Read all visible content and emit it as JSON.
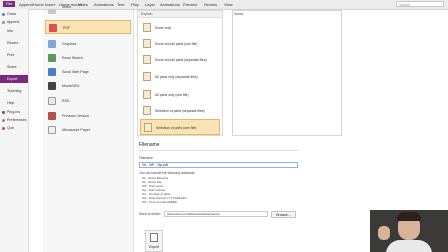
{
  "menubar": {
    "items": [
      "File",
      "Append",
      "Home",
      "Insert",
      "Home mount",
      "Video",
      "Animations",
      "Text",
      "Play",
      "Layer",
      "Animations",
      "Preview",
      "Review",
      "View"
    ],
    "active_index": 0,
    "search_placeholder": "Search"
  },
  "sidebar": {
    "items": [
      {
        "label": "Close",
        "icon": "folder-icon"
      },
      {
        "label": "Append",
        "icon": "document-icon"
      },
      {
        "label": "Info",
        "icon": ""
      },
      {
        "label": "Recent",
        "icon": ""
      },
      {
        "label": "Print",
        "icon": ""
      },
      {
        "label": "Share",
        "icon": ""
      },
      {
        "label": "Export",
        "icon": ""
      },
      {
        "label": "Teaching",
        "icon": ""
      },
      {
        "label": "Help",
        "icon": ""
      },
      {
        "label": "Plug-ins",
        "icon": "plugin-icon"
      },
      {
        "label": "Preferences",
        "icon": "gear-icon"
      },
      {
        "label": "Quit",
        "icon": "quit-icon"
      }
    ],
    "active_label": "Export"
  },
  "types": {
    "items": [
      {
        "label": "Video"
      },
      {
        "label": "PDF"
      },
      {
        "label": "Graphics"
      },
      {
        "label": "Excel Sketch"
      },
      {
        "label": "Scroll Web Page"
      },
      {
        "label": "Movie/URL"
      },
      {
        "label": "RSS"
      },
      {
        "label": "Previous Version"
      },
      {
        "label": "Micrascript Paper"
      }
    ],
    "active_label": "PDF"
  },
  "options": {
    "header": "Explain",
    "items": [
      "Score only",
      "Score and all parts (one file)",
      "Score and all parts (separate files)",
      "All parts only (separate files)",
      "All parts only (one file)",
      "Selection of parts (separate files)",
      "Selection of parts (one file)"
    ],
    "active_label": "Selection of parts (one file)"
  },
  "notes": {
    "label": "Notes"
  },
  "filename": {
    "section_title": "Filename",
    "field_label": "Filename",
    "value": "%t - %P - %p.pdf",
    "wildcard_intro": "You can include the following wildcards:",
    "wildcards": [
      "%f - Score filename",
      "%t - Score title",
      "%P - Part name",
      "%p - Part number",
      "%n - Number of parts",
      "%d - Date (format YYYY-MM-DD)",
      "%h - Time (format HHMM)"
    ],
    "save_label": "Save to folder:",
    "save_path": "/Users/tomecsoft/Downloads/arpuccos",
    "browse_label": "Browse..."
  },
  "export_button": {
    "label": "Export"
  },
  "colors": {
    "accent": "#7a2a7e",
    "selected_bg": "#fbe3b3",
    "selected_border": "#e0b96a"
  }
}
